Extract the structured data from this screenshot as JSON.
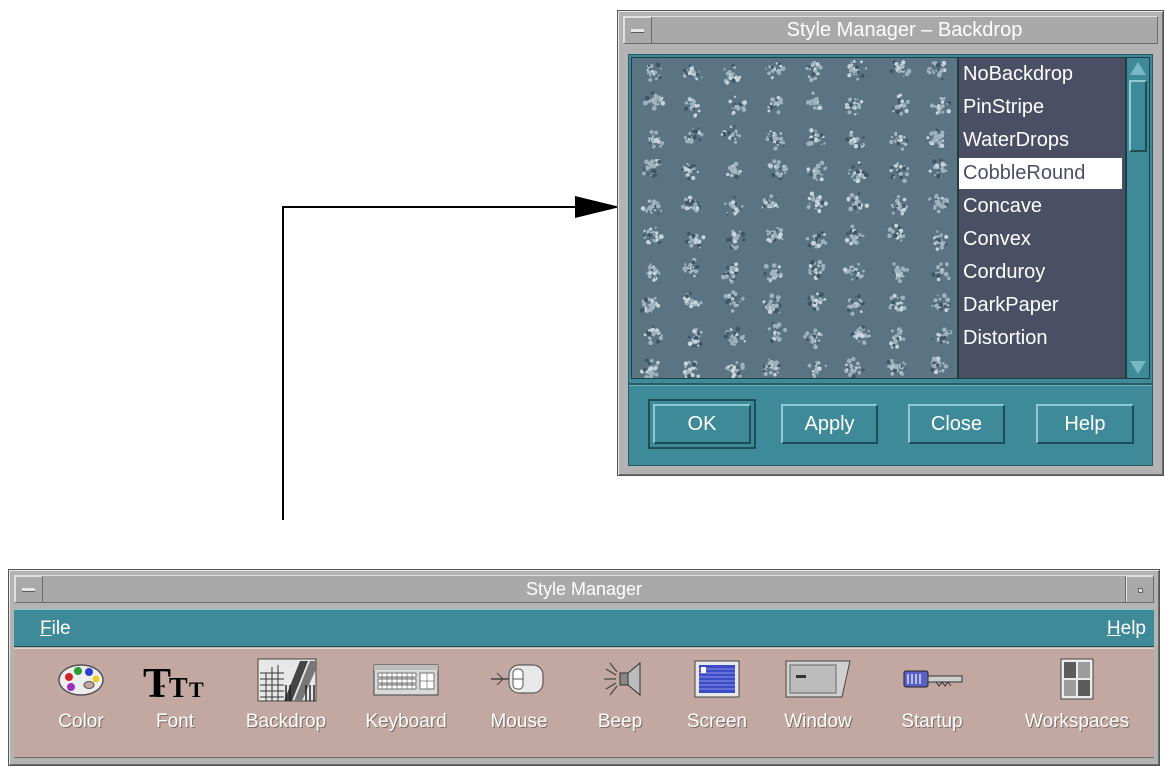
{
  "backdrop_dialog": {
    "title": "Style Manager – Backdrop",
    "backdrops": [
      "NoBackdrop",
      "PinStripe",
      "WaterDrops",
      "CobbleRound",
      "Concave",
      "Convex",
      "Corduroy",
      "DarkPaper",
      "Distortion"
    ],
    "selected": "CobbleRound",
    "buttons": {
      "ok": "OK",
      "apply": "Apply",
      "close": "Close",
      "help": "Help"
    }
  },
  "main_window": {
    "title": "Style Manager",
    "menu": {
      "file": {
        "mnemonic": "F",
        "rest": "ile"
      },
      "help": {
        "mnemonic": "H",
        "rest": "elp"
      }
    },
    "tools": [
      {
        "label": "Color",
        "icon": "palette-icon"
      },
      {
        "label": "Font",
        "icon": "font-icon"
      },
      {
        "label": "Backdrop",
        "icon": "backdrop-icon"
      },
      {
        "label": "Keyboard",
        "icon": "keyboard-icon"
      },
      {
        "label": "Mouse",
        "icon": "mouse-icon"
      },
      {
        "label": "Beep",
        "icon": "speaker-icon"
      },
      {
        "label": "Screen",
        "icon": "screen-icon"
      },
      {
        "label": "Window",
        "icon": "window-icon"
      },
      {
        "label": "Startup",
        "icon": "key-icon"
      },
      {
        "label": "Workspaces",
        "icon": "workspaces-icon"
      }
    ]
  },
  "colors": {
    "motif_teal": "#3e8a98",
    "title_grey": "#a9a9a9",
    "iconbar_rose": "#c2a8a1",
    "list_bg": "#4a4f64",
    "preview_bg": "#5a7484"
  }
}
